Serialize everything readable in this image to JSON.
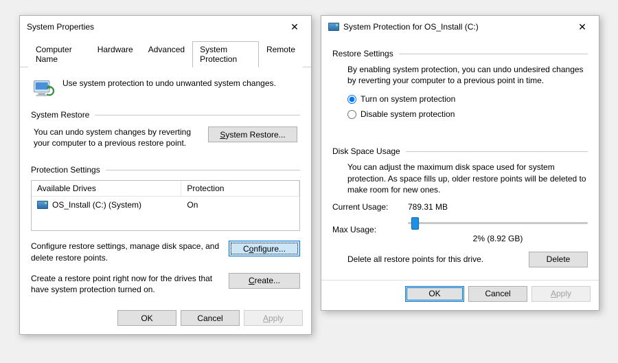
{
  "left": {
    "title": "System Properties",
    "tabs": [
      "Computer Name",
      "Hardware",
      "Advanced",
      "System Protection",
      "Remote"
    ],
    "active_tab_index": 3,
    "intro": "Use system protection to undo unwanted system changes.",
    "group_restore": {
      "title": "System Restore",
      "text": "You can undo system changes by reverting your computer to a previous restore point.",
      "button": "System Restore..."
    },
    "group_settings": {
      "title": "Protection Settings",
      "columns": [
        "Available Drives",
        "Protection"
      ],
      "rows": [
        {
          "drive": "OS_Install (C:) (System)",
          "protection": "On"
        }
      ],
      "configure_text": "Configure restore settings, manage disk space, and delete restore points.",
      "configure_button": "Configure...",
      "create_text": "Create a restore point right now for the drives that have system protection turned on.",
      "create_button": "Create..."
    },
    "footer": {
      "ok": "OK",
      "cancel": "Cancel",
      "apply": "Apply"
    }
  },
  "right": {
    "title": "System Protection for OS_Install (C:)",
    "group_restore": {
      "title": "Restore Settings",
      "intro": "By enabling system protection, you can undo undesired changes by reverting your computer to a previous point in time.",
      "radio_on": "Turn on system protection",
      "radio_off": "Disable system protection",
      "selected": "on"
    },
    "group_disk": {
      "title": "Disk Space Usage",
      "intro": "You can adjust the maximum disk space used for system protection. As space fills up, older restore points will be deleted to make room for new ones.",
      "current_label": "Current Usage:",
      "current_value": "789.31 MB",
      "max_label": "Max Usage:",
      "slider_percent": 2,
      "slider_caption": "2% (8.92 GB)",
      "delete_text": "Delete all restore points for this drive.",
      "delete_button": "Delete"
    },
    "footer": {
      "ok": "OK",
      "cancel": "Cancel",
      "apply": "Apply"
    }
  }
}
